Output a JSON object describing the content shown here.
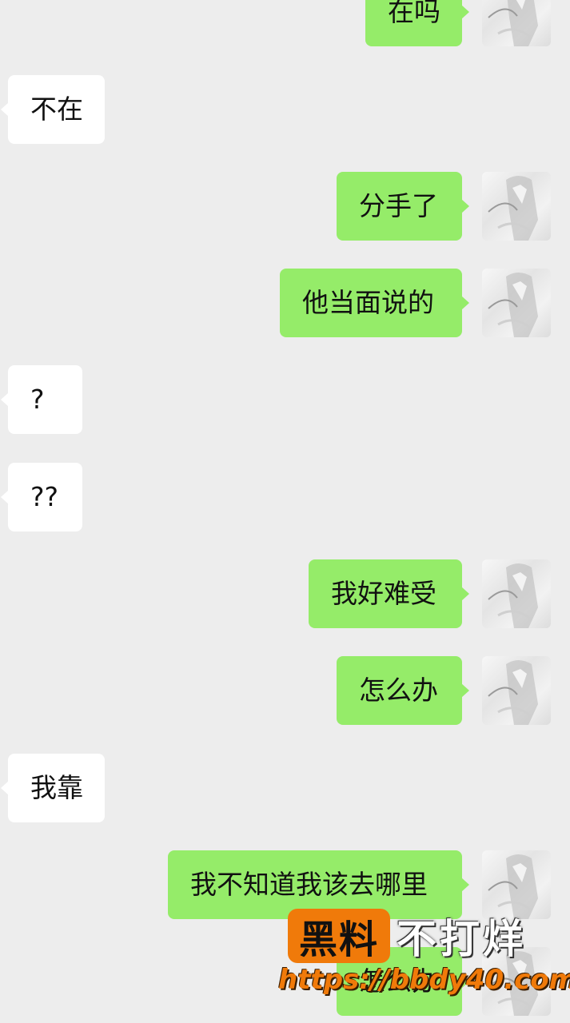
{
  "messages": [
    {
      "side": "out",
      "text": "在吗"
    },
    {
      "side": "in",
      "text": "不在"
    },
    {
      "side": "out",
      "text": "分手了"
    },
    {
      "side": "out",
      "text": "他当面说的"
    },
    {
      "side": "in",
      "text": "?"
    },
    {
      "side": "in",
      "text": "??"
    },
    {
      "side": "out",
      "text": "我好难受"
    },
    {
      "side": "out",
      "text": "怎么办"
    },
    {
      "side": "in",
      "text": "我靠"
    },
    {
      "side": "out",
      "text": "我不知道我该去哪里"
    },
    {
      "side": "out",
      "text": "怎么办"
    }
  ],
  "watermark": {
    "brand": "黑料",
    "slogan": "不打烊",
    "url": "https://bbdy40.com"
  },
  "colors": {
    "background": "#ededed",
    "outgoing_bubble": "#95ec69",
    "incoming_bubble": "#ffffff",
    "watermark_accent": "#f07a0a"
  },
  "icons": {
    "avatar": "anime-girl-avatar"
  }
}
